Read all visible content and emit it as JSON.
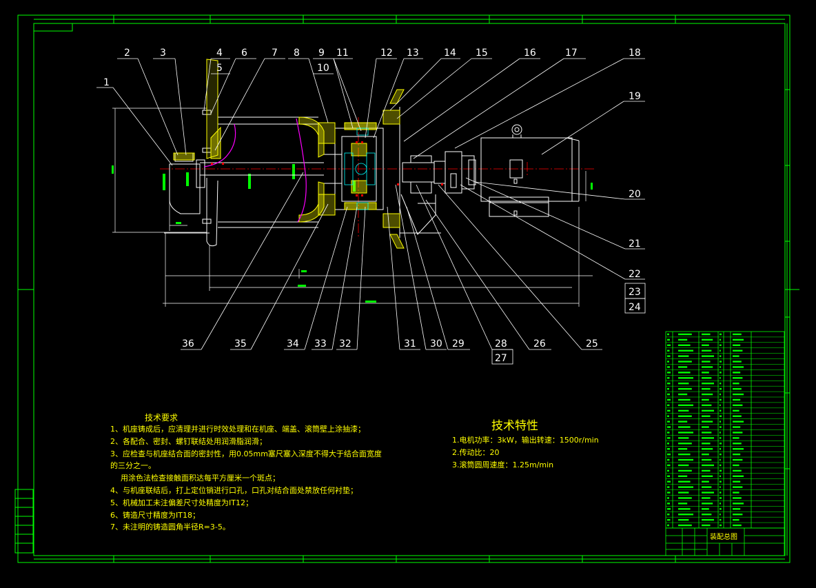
{
  "colors": {
    "background": "#000000",
    "frame": "#00ff00",
    "outline": "#ffffff",
    "centerline": "#ff0000",
    "text": "#ffff00",
    "hatch": "#ffff00",
    "pinkline": "#ff00ff",
    "cyan": "#00ffff"
  },
  "drawing": {
    "balloons_top": [
      "1",
      "2",
      "3",
      "4",
      "5",
      "6",
      "7",
      "8",
      "9",
      "10",
      "11",
      "12",
      "13",
      "14",
      "15",
      "16",
      "17",
      "18",
      "19"
    ],
    "balloons_right": [
      "20",
      "21",
      "22",
      "23",
      "24"
    ],
    "balloons_bottom": [
      "36",
      "35",
      "34",
      "33",
      "32",
      "31",
      "30",
      "29",
      "28",
      "27",
      "26",
      "25"
    ]
  },
  "tech_requirements": {
    "title": "技术要求",
    "items": [
      "1、机座铸成后，应清理并进行时效处理和在机座、端盖、滚筒壁上涂抽漆；",
      "2、各配合、密封、螺钉联结处用润滑脂润滑；",
      "3、应检查与机座结合面的密封性，用0.05mm塞尺塞入深度不得大于结合面宽度",
      "的三分之一。",
      "用涂色法检查接触面积达每平方厘米一个斑点；",
      "4、与机座联结后，打上定位销进行口孔，口孔对结合面处禁放任何衬垫；",
      "5、机械加工未注偏差尺寸处精度为IT12；",
      "6、铸造尺寸精度为IT18；",
      "7、未注明的铸造圆角半径R=3-5。"
    ]
  },
  "tech_specs": {
    "title": "技术特性",
    "items": [
      "1.电机功率：3kW，输出转速：1500r/min",
      "2.传动比：20",
      "3.滚筒圆周速度：1.25m/min"
    ]
  },
  "title_block": {
    "drawing_name": "装配总图"
  }
}
